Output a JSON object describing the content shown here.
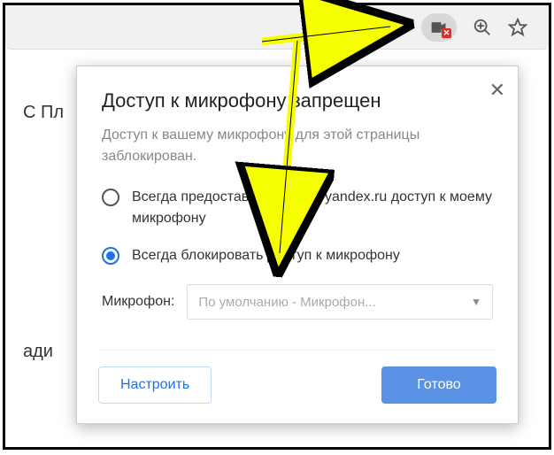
{
  "background": {
    "text_fragment_1": "С Пл",
    "text_fragment_2": "ади"
  },
  "toolbar": {
    "camera_icon": "camera-blocked-icon",
    "zoom_icon": "zoom-in-icon",
    "star_icon": "star-icon"
  },
  "popup": {
    "title": "Доступ к микрофону запрещен",
    "description": "Доступ к вашему микрофону для этой страницы заблокирован.",
    "close_label": "✕",
    "radio": {
      "option_allow": "Всегда предоставлять https://yandex.ru доступ к моему микрофону",
      "option_block": "Всегда блокировать доступ к микрофону",
      "selected": "block"
    },
    "mic": {
      "label": "Микрофон:",
      "selected": "По умолчанию - Микрофон..."
    },
    "buttons": {
      "configure": "Настроить",
      "done": "Готово"
    }
  }
}
